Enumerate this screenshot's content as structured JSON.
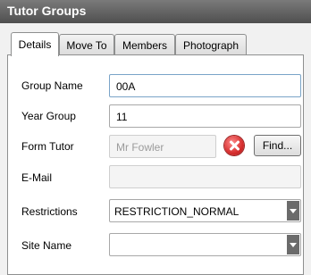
{
  "window": {
    "title": "Tutor Groups"
  },
  "tabs": [
    {
      "label": "Details",
      "active": true
    },
    {
      "label": "Move To",
      "active": false
    },
    {
      "label": "Members",
      "active": false
    },
    {
      "label": "Photograph",
      "active": false
    }
  ],
  "form": {
    "group_name": {
      "label": "Group Name",
      "value": "00A"
    },
    "year_group": {
      "label": "Year Group",
      "value": "11"
    },
    "form_tutor": {
      "label": "Form Tutor",
      "value": "Mr Fowler",
      "find_label": "Find..."
    },
    "email": {
      "label": "E-Mail",
      "value": ""
    },
    "restrictions": {
      "label": "Restrictions",
      "selected": "RESTRICTION_NORMAL"
    },
    "site_name": {
      "label": "Site Name",
      "selected": ""
    }
  },
  "icons": {
    "clear": "clear-x-icon",
    "dropdown": "chevron-down-icon"
  },
  "colors": {
    "titlebar": "#5e5e5e",
    "clear_button": "#d62d2d",
    "focus_border": "#7aa4c8"
  }
}
